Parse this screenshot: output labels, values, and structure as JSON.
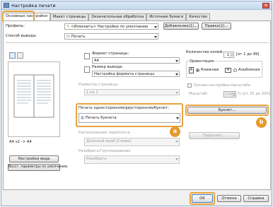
{
  "window": {
    "title": "Настройка печати",
    "close": "✕"
  },
  "tabs": [
    "Основные настройки",
    "Макет страницы",
    "Окончательная обработка",
    "Источник бумаги",
    "Качество"
  ],
  "profile": {
    "label": "Профиль:",
    "value": "<Изменить> Настройки по умолчанию",
    "add_button": "Добавление(1)...",
    "edit_button": "Правка(2)..."
  },
  "output_method": {
    "label": "Способ вывода:",
    "value": "Печать"
  },
  "page_size": {
    "label": "Формат страницы:",
    "value": "A4"
  },
  "output_size": {
    "label": "Размер вывода:",
    "value": "Настройка формата страницы"
  },
  "layout": {
    "label": "Разметка страницы:",
    "value": "1 на 1"
  },
  "duplex": {
    "label": "Печать односторонняя/двусторонняя/буклет:",
    "value": "Печать буклета"
  },
  "binding": {
    "label": "Расположение переплета:",
    "value": "Длинный край [Слева]"
  },
  "binding_button": "Переплет...",
  "collate": {
    "label": "Разобрать/Группирование",
    "value": "Разобрать"
  },
  "copies": {
    "label": "Количество копий:",
    "value": "1",
    "range": "[от 1 до 99]"
  },
  "orientation": {
    "label": "Ориентация",
    "portrait": "Книжная",
    "landscape": "Альбомная"
  },
  "manual_scaling": {
    "label": "Ручная настройка масштаба",
    "scale_label": "Масштаб:",
    "value": "100",
    "range": "% [от 25 до 200]"
  },
  "booklet_button": "Буклет...",
  "preview_caption": "A4 x2 -> A4",
  "view_settings_button": "Настройки вида",
  "restore_defaults_button": "Восст. параметры по умолчанию",
  "badges": {
    "a": "a",
    "b": "b"
  },
  "footer": {
    "ok": "OK",
    "cancel": "Отмена",
    "help": "Справка"
  }
}
